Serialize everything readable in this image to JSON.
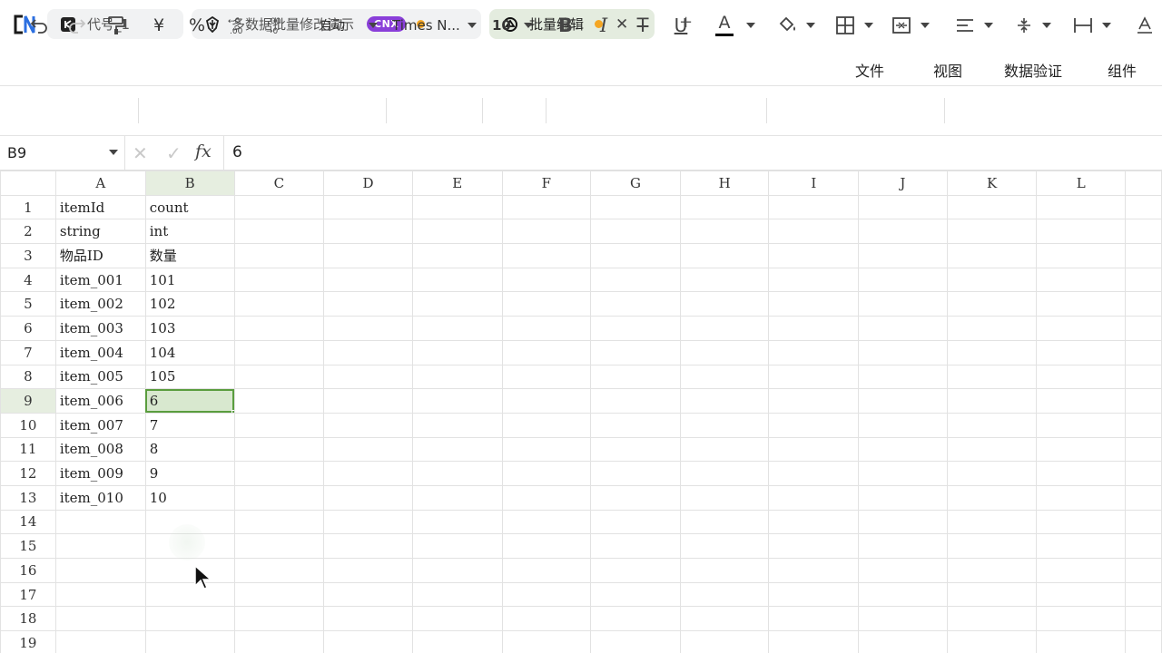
{
  "tabs": [
    {
      "label": "代号_1",
      "icon": "code-icon",
      "active": false
    },
    {
      "label": "多数据批量修改演示",
      "icon": "shield-icon",
      "badge": "CNX",
      "unsaved": true,
      "active": false
    },
    {
      "label": "批量编辑",
      "icon": "openai-icon",
      "unsaved": true,
      "active": true
    }
  ],
  "menu": [
    "文件",
    "视图",
    "数据验证",
    "组件"
  ],
  "toolbar": {
    "number_format": "自动",
    "font_family": "Times N...",
    "font_size": "10",
    "currency_symbol": "¥",
    "percent_symbol": "%",
    "font_color": "A",
    "text_color_underline": "#000000"
  },
  "formula_bar": {
    "cell_ref": "B9",
    "fx_label": "fx",
    "value": "6"
  },
  "grid": {
    "columns": [
      "A",
      "B",
      "C",
      "D",
      "E",
      "F",
      "G",
      "H",
      "I",
      "J",
      "K",
      "L"
    ],
    "rows": [
      [
        "itemId",
        "count"
      ],
      [
        "string",
        "int"
      ],
      [
        "物品ID",
        "数量"
      ],
      [
        "item_001",
        "101"
      ],
      [
        "item_002",
        "102"
      ],
      [
        "item_003",
        "103"
      ],
      [
        "item_004",
        "104"
      ],
      [
        "item_005",
        "105"
      ],
      [
        "item_006",
        "6"
      ],
      [
        "item_007",
        "7"
      ],
      [
        "item_008",
        "8"
      ],
      [
        "item_009",
        "9"
      ],
      [
        "item_010",
        "10"
      ],
      [
        "",
        ""
      ],
      [
        "",
        ""
      ],
      [
        "",
        ""
      ],
      [
        "",
        ""
      ],
      [
        "",
        ""
      ],
      [
        "",
        ""
      ]
    ],
    "row_numbers": [
      "1",
      "2",
      "3",
      "4",
      "5",
      "6",
      "7",
      "8",
      "9",
      "10",
      "11",
      "12",
      "13",
      "14",
      "15",
      "16",
      "17",
      "18",
      "19"
    ],
    "selected_row": "9",
    "selected_col": "B"
  },
  "colors": {
    "accent": "#5a9d3e",
    "selection_fill": "#d8e8cf",
    "badge": "#8a3fd9",
    "unsaved_dot": "#f5a623"
  }
}
